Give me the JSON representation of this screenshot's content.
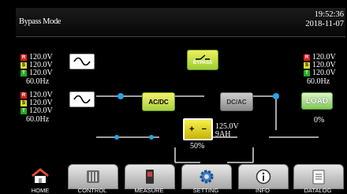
{
  "header": {
    "mode": "Bypass Mode",
    "time": "19:52:36",
    "date": "2018-11-07"
  },
  "input1": {
    "r": "120.0V",
    "s": "120.0V",
    "t": "120.0V",
    "freq": "60.0Hz"
  },
  "input2": {
    "r": "120.0V",
    "s": "120.0V",
    "t": "120.0V",
    "freq": "60.0Hz"
  },
  "output": {
    "r": "120.0V",
    "s": "120.0V",
    "t": "120.0V",
    "freq": "60.0Hz",
    "load_pct": "0%"
  },
  "phase_tags": {
    "r": "R",
    "s": "S",
    "t": "T"
  },
  "blocks": {
    "bypass": "BYPASS",
    "rectifier": "AC/DC",
    "inverter": "DC/AC",
    "load": "LOAD"
  },
  "battery": {
    "voltage": "125.0V",
    "capacity": "9AH",
    "percent": "50%"
  },
  "nav": [
    {
      "label": "HOME",
      "icon": "house-icon"
    },
    {
      "label": "CONTROL",
      "icon": "sliders-icon"
    },
    {
      "label": "MEASURE",
      "icon": "meter-icon"
    },
    {
      "label": "SETTING",
      "icon": "gear-icon"
    },
    {
      "label": "INFO",
      "icon": "info-icon"
    },
    {
      "label": "DATALOG",
      "icon": "log-icon"
    }
  ],
  "colors": {
    "accent_blue": "#29a3e6",
    "green": "#7fc855",
    "yellow": "#f7ef50"
  }
}
